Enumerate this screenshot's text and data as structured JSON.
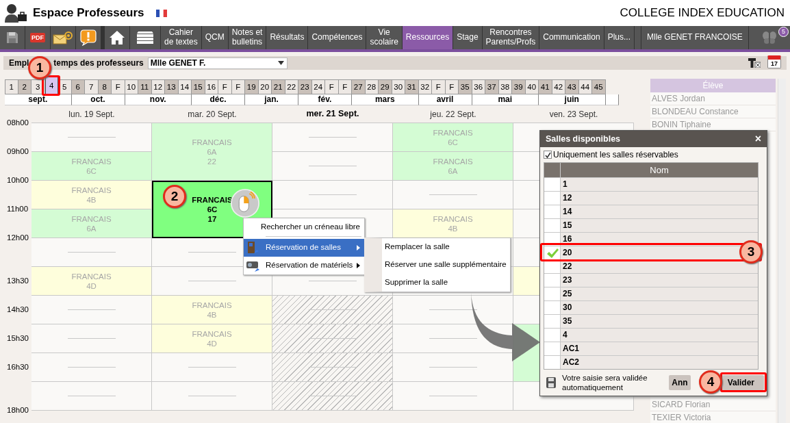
{
  "header": {
    "title": "Espace Professeurs",
    "school": "COLLEGE INDEX EDUCATION"
  },
  "toolbar": {
    "pdf_label": "PDF",
    "menu": [
      {
        "label": "Cahier\nde textes",
        "selected": false
      },
      {
        "label": "QCM",
        "selected": false
      },
      {
        "label": "Notes et\nbulletins",
        "selected": false
      },
      {
        "label": "Résultats",
        "selected": false
      },
      {
        "label": "Compétences",
        "selected": false
      },
      {
        "label": "Vie\nscolaire",
        "selected": false
      },
      {
        "label": "Ressources",
        "selected": true
      },
      {
        "label": "Stage",
        "selected": false
      },
      {
        "label": "Rencontres\nParents/Profs",
        "selected": false
      },
      {
        "label": "Communication",
        "selected": false
      },
      {
        "label": "Plus...",
        "selected": false
      }
    ],
    "user": "Mlle GENET FRANCOISE",
    "notification_count": "5"
  },
  "schedule": {
    "title": [
      "Empl",
      "temps des professeurs"
    ],
    "teacher": "Mlle GENET F.",
    "calendar_day": "17"
  },
  "weeks": [
    {
      "label": "1",
      "shaded": false,
      "selected": false
    },
    {
      "label": "2",
      "shaded": true,
      "selected": false
    },
    {
      "label": "3",
      "shaded": false,
      "selected": false
    },
    {
      "label": "4",
      "shaded": false,
      "selected": true
    },
    {
      "label": "5",
      "shaded": false,
      "selected": false
    },
    {
      "label": "6",
      "shaded": true,
      "selected": false
    },
    {
      "label": "7",
      "shaded": false,
      "selected": false
    },
    {
      "label": "8",
      "shaded": true,
      "selected": false
    },
    {
      "label": "F",
      "shaded": false,
      "selected": false
    },
    {
      "label": "10",
      "shaded": false,
      "selected": false
    },
    {
      "label": "11",
      "shaded": true,
      "selected": false
    },
    {
      "label": "12",
      "shaded": false,
      "selected": false
    },
    {
      "label": "13",
      "shaded": true,
      "selected": false
    },
    {
      "label": "14",
      "shaded": false,
      "selected": false
    },
    {
      "label": "15",
      "shaded": true,
      "selected": false
    },
    {
      "label": "16",
      "shaded": false,
      "selected": false
    },
    {
      "label": "F",
      "shaded": false,
      "selected": false
    },
    {
      "label": "F",
      "shaded": false,
      "selected": false
    },
    {
      "label": "19",
      "shaded": true,
      "selected": false
    },
    {
      "label": "20",
      "shaded": false,
      "selected": false
    },
    {
      "label": "21",
      "shaded": true,
      "selected": false
    },
    {
      "label": "22",
      "shaded": false,
      "selected": false
    },
    {
      "label": "23",
      "shaded": true,
      "selected": false
    },
    {
      "label": "24",
      "shaded": false,
      "selected": false
    },
    {
      "label": "F",
      "shaded": false,
      "selected": false
    },
    {
      "label": "F",
      "shaded": false,
      "selected": false
    },
    {
      "label": "27",
      "shaded": true,
      "selected": false
    },
    {
      "label": "28",
      "shaded": false,
      "selected": false
    },
    {
      "label": "29",
      "shaded": true,
      "selected": false
    },
    {
      "label": "30",
      "shaded": false,
      "selected": false
    },
    {
      "label": "31",
      "shaded": true,
      "selected": false
    },
    {
      "label": "32",
      "shaded": false,
      "selected": false
    },
    {
      "label": "F",
      "shaded": false,
      "selected": false
    },
    {
      "label": "F",
      "shaded": false,
      "selected": false
    },
    {
      "label": "35",
      "shaded": true,
      "selected": false
    },
    {
      "label": "36",
      "shaded": false,
      "selected": false
    },
    {
      "label": "37",
      "shaded": true,
      "selected": false
    },
    {
      "label": "38",
      "shaded": false,
      "selected": false
    },
    {
      "label": "39",
      "shaded": true,
      "selected": false
    },
    {
      "label": "40",
      "shaded": false,
      "selected": false
    },
    {
      "label": "41",
      "shaded": true,
      "selected": false
    },
    {
      "label": "42",
      "shaded": false,
      "selected": false
    },
    {
      "label": "43",
      "shaded": true,
      "selected": false
    },
    {
      "label": "44",
      "shaded": false,
      "selected": false
    },
    {
      "label": "45",
      "shaded": true,
      "selected": false
    }
  ],
  "months": [
    "sept.",
    "oct.",
    "nov.",
    "déc.",
    "jan.",
    "fév.",
    "mars",
    "avril",
    "mai",
    "juin"
  ],
  "days": [
    {
      "label": "lun. 19 Sept.",
      "current": false
    },
    {
      "label": "mar. 20 Sept.",
      "current": false
    },
    {
      "label": "mer. 21 Sept.",
      "current": true
    },
    {
      "label": "jeu. 22 Sept.",
      "current": false
    },
    {
      "label": "ven. 23 Sept.",
      "current": false
    }
  ],
  "times": [
    "08h00",
    "09h00",
    "10h00",
    "11h00",
    "12h00",
    "13h30",
    "14h30",
    "15h30",
    "16h30",
    "18h00"
  ],
  "columns": [
    {
      "slots": [
        {
          "kind": "empty"
        },
        {
          "kind": "course",
          "color": "#d4fcd4",
          "lines": [
            "FRANCAIS",
            "6C"
          ]
        },
        {
          "kind": "course",
          "color": "#fefedc",
          "lines": [
            "FRANCAIS",
            "4B"
          ]
        },
        {
          "kind": "course",
          "color": "#d4fcd4",
          "lines": [
            "FRANCAIS",
            "6A"
          ]
        },
        {
          "kind": "empty"
        },
        {
          "kind": "course",
          "color": "#fefedc",
          "lines": [
            "FRANCAIS",
            "4D"
          ]
        },
        {
          "kind": "empty"
        },
        {
          "kind": "empty"
        },
        {
          "kind": "empty"
        },
        {
          "kind": "empty"
        }
      ]
    },
    {
      "slots": [
        {
          "kind": "course",
          "color": "#d4fcd4",
          "lines": [
            "FRANCAIS",
            "6A",
            "22"
          ]
        },
        {
          "kind": "selected",
          "color": "#80ff80",
          "lines": [
            "FRANCAIS",
            "6C",
            "17"
          ]
        },
        {
          "kind": "empty"
        },
        {
          "kind": "empty"
        },
        {
          "kind": "course",
          "color": "#fefedc",
          "lines": [
            "FRANCAIS",
            "4B"
          ]
        },
        {
          "kind": "course",
          "color": "#fefedc",
          "lines": [
            "FRANCAIS",
            "4D"
          ]
        },
        {
          "kind": "empty"
        },
        {
          "kind": "empty"
        }
      ]
    },
    {
      "slots": [
        {
          "kind": "empty"
        },
        {
          "kind": "empty"
        },
        {
          "kind": "empty"
        },
        {
          "kind": "empty"
        },
        {
          "kind": "empty"
        },
        {
          "kind": "empty"
        },
        {
          "kind": "hatched"
        },
        {
          "kind": "hatched"
        },
        {
          "kind": "hatched"
        },
        {
          "kind": "hatched"
        }
      ]
    },
    {
      "slots": [
        {
          "kind": "course",
          "color": "#d4fcd4",
          "lines": [
            "FRANCAIS",
            "6C"
          ]
        },
        {
          "kind": "course",
          "color": "#d4fcd4",
          "lines": [
            "FRANCAIS",
            "6A"
          ]
        },
        {
          "kind": "empty"
        },
        {
          "kind": "course",
          "color": "#fefedc",
          "lines": [
            "FRANCAIS",
            "4B"
          ]
        },
        {
          "kind": "empty"
        },
        {
          "kind": "empty"
        },
        {
          "kind": "empty"
        },
        {
          "kind": "empty"
        },
        {
          "kind": "empty"
        },
        {
          "kind": "empty"
        }
      ]
    },
    {
      "slots": [
        {
          "kind": "empty"
        },
        {
          "kind": "empty"
        },
        {
          "kind": "empty"
        },
        {
          "kind": "empty"
        },
        {
          "kind": "empty"
        },
        {
          "kind": "course",
          "color": "#fefedc"
        },
        {
          "kind": "empty"
        },
        {
          "kind": "course",
          "color": "#d4fcd4"
        },
        {
          "kind": "empty"
        }
      ]
    }
  ],
  "context_menu": [
    {
      "label": "Rechercher un créneau libre",
      "kind": "plain",
      "selected": false
    },
    {
      "label": "Réservation de salles",
      "kind": "rooms",
      "selected": true
    },
    {
      "label": "Réservation de matériels",
      "kind": "equipment",
      "selected": false
    }
  ],
  "submenu": [
    "Remplacer la salle",
    "Réserver une salle supplémentaire",
    "Supprimer la salle"
  ],
  "dialog": {
    "title": "Salles disponibles",
    "close": "×",
    "filter": {
      "label": "Uniquement les salles réservables",
      "checked": true
    },
    "column": "Nom",
    "rooms": [
      {
        "name": "1",
        "selected": false
      },
      {
        "name": "12",
        "selected": false
      },
      {
        "name": "14",
        "selected": false
      },
      {
        "name": "15",
        "selected": false
      },
      {
        "name": "16",
        "selected": false
      },
      {
        "name": "20",
        "selected": true
      },
      {
        "name": "22",
        "selected": false
      },
      {
        "name": "23",
        "selected": false
      },
      {
        "name": "25",
        "selected": false
      },
      {
        "name": "30",
        "selected": false
      },
      {
        "name": "35",
        "selected": false
      },
      {
        "name": "4",
        "selected": false
      },
      {
        "name": "AC1",
        "selected": false
      },
      {
        "name": "AC2",
        "selected": false
      }
    ],
    "note": "Votre saisie sera validée automatiquement",
    "buttons": [
      "Ann",
      "Valider"
    ]
  },
  "students": {
    "header": "Élève",
    "top": [
      "ALVES Jordan",
      "BLONDEAU Constance",
      "BONIN Tiphaine"
    ],
    "bottom": [
      "SICARD Florian",
      "TEXIER Victoria"
    ]
  },
  "callouts": [
    "1",
    "2",
    "3",
    "4"
  ]
}
